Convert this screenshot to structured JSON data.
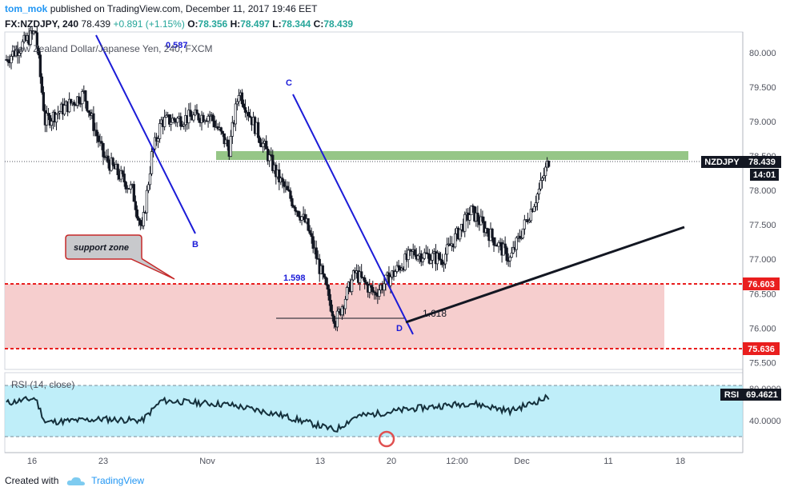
{
  "header": {
    "author": "tom_mok",
    "published_text": "published on TradingView.com, December 11, 2017 19:46 EET",
    "symbol": "FX:NZDJPY, 240",
    "last": "78.439",
    "change": "+0.891 (+1.15%)",
    "o_label": "O:",
    "o": "78.356",
    "h_label": "H:",
    "h": "78.497",
    "l_label": "L:",
    "l": "78.344",
    "c_label": "C:",
    "c": "78.439"
  },
  "subtitle": "New Zealand Dollar/Japanese Yen, 240, FXCM",
  "footer": {
    "created_with": "Created with",
    "brand": "TradingView"
  },
  "chart_data": [
    {
      "type": "candlestick",
      "symbol": "NZDJPY",
      "ylim": [
        75.4,
        80.3
      ],
      "y_ticks": [
        "80.000",
        "79.500",
        "79.000",
        "78.500",
        "78.000",
        "77.500",
        "77.000",
        "76.500",
        "76.000",
        "75.500"
      ],
      "x_ticks": [
        "16",
        "23",
        "Nov",
        "13",
        "20",
        "12:00",
        "Dec",
        "11",
        "18"
      ],
      "approx_path": [
        {
          "x": "Oct 16",
          "y": 79.9
        },
        {
          "x": "Oct 19",
          "y": 80.3
        },
        {
          "x": "Oct 20",
          "y": 79.0
        },
        {
          "x": "Oct 24",
          "y": 79.4
        },
        {
          "x": "Oct 26",
          "y": 78.5
        },
        {
          "x": "Oct 29",
          "y": 78.0
        },
        {
          "x": "Oct 30",
          "y": 77.4
        },
        {
          "x": "Oct 31",
          "y": 78.5
        },
        {
          "x": "Nov 1",
          "y": 79.0
        },
        {
          "x": "Nov 6",
          "y": 79.1
        },
        {
          "x": "Nov 8",
          "y": 78.6
        },
        {
          "x": "Nov 9",
          "y": 79.45
        },
        {
          "x": "Nov 13",
          "y": 78.2
        },
        {
          "x": "Nov 16",
          "y": 77.5
        },
        {
          "x": "Nov 19",
          "y": 76.1
        },
        {
          "x": "Nov 21",
          "y": 76.8
        },
        {
          "x": "Nov 23",
          "y": 76.5
        },
        {
          "x": "Nov 27",
          "y": 77.1
        },
        {
          "x": "Nov 30",
          "y": 77.0
        },
        {
          "x": "Dec 3",
          "y": 77.7
        },
        {
          "x": "Dec 7",
          "y": 77.0
        },
        {
          "x": "Dec 10",
          "y": 78.0
        },
        {
          "x": "Dec 11",
          "y": 78.44
        }
      ],
      "last_price_label": "NZDJPY",
      "last_price": "78.439",
      "countdown": "14:01",
      "levels": [
        {
          "value": "76.603"
        },
        {
          "value": "75.636"
        }
      ],
      "resistance_zone": [
        78.5,
        78.6
      ],
      "annotations": {
        "point_b": "B",
        "point_c": "C",
        "point_d": "D",
        "fib_top": "0.587",
        "fib_1598": "1.598",
        "fib_1618": "1.618",
        "callout": "support zone"
      },
      "colors": {
        "up": "#ffffff",
        "down": "#131722",
        "zone": "#f5c6c6",
        "level": "#e91e1e",
        "green_zone": "#8bc07a",
        "trend": "#1b1bd8"
      }
    },
    {
      "type": "line",
      "name": "RSI (14, close)",
      "value_label": "RSI",
      "value": "69.4621",
      "ylim": [
        0,
        100
      ],
      "y_ticks": [
        "80.0000",
        "40.0000"
      ],
      "band": [
        30,
        70
      ],
      "approx_path": [
        {
          "x": "Oct 16",
          "y": 62
        },
        {
          "x": "Oct 19",
          "y": 68
        },
        {
          "x": "Oct 20",
          "y": 38
        },
        {
          "x": "Oct 26",
          "y": 42
        },
        {
          "x": "Oct 30",
          "y": 40
        },
        {
          "x": "Nov 1",
          "y": 65
        },
        {
          "x": "Nov 8",
          "y": 60
        },
        {
          "x": "Nov 13",
          "y": 48
        },
        {
          "x": "Nov 19",
          "y": 28
        },
        {
          "x": "Nov 21",
          "y": 45
        },
        {
          "x": "Nov 27",
          "y": 55
        },
        {
          "x": "Dec 3",
          "y": 62
        },
        {
          "x": "Dec 7",
          "y": 52
        },
        {
          "x": "Dec 11",
          "y": 69.46
        }
      ]
    }
  ]
}
